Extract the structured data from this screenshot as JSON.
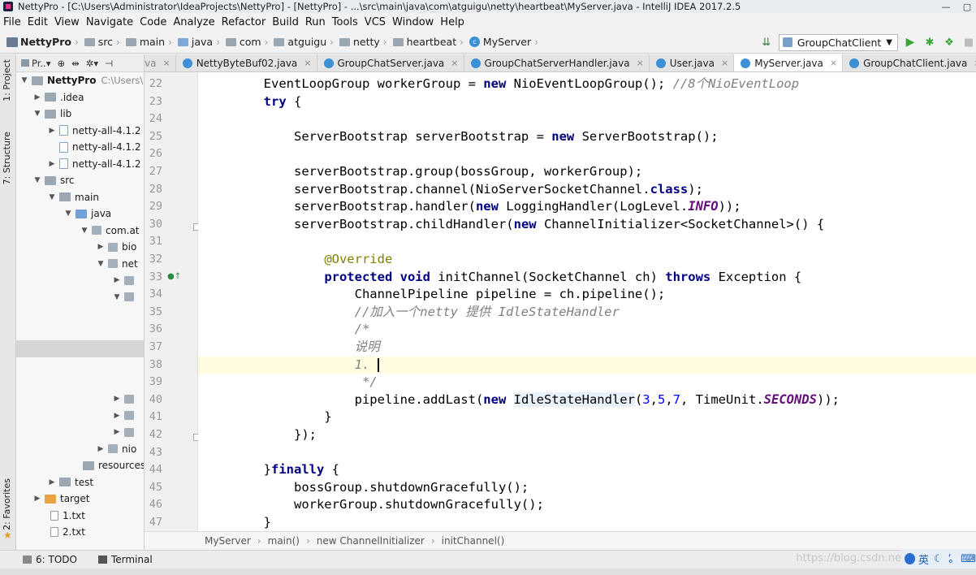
{
  "window": {
    "title": "NettyPro - [C:\\Users\\Administrator\\IdeaProjects\\NettyPro] - [NettyPro] - ...\\src\\main\\java\\com\\atguigu\\netty\\heartbeat\\MyServer.java - IntelliJ IDEA 2017.2.5",
    "minimize": "—"
  },
  "menu": [
    "File",
    "Edit",
    "View",
    "Navigate",
    "Code",
    "Analyze",
    "Refactor",
    "Build",
    "Run",
    "Tools",
    "VCS",
    "Window",
    "Help"
  ],
  "breadcrumb": [
    "NettyPro",
    "src",
    "main",
    "java",
    "com",
    "atguigu",
    "netty",
    "heartbeat",
    "MyServer"
  ],
  "run_config": "GroupChatClient",
  "left_strip": {
    "project": "1: Project",
    "structure": "7: Structure",
    "favorites": "2: Favorites"
  },
  "project_panel": {
    "header": "Pr..▾",
    "rows": [
      {
        "label": "NettyPro",
        "secondary": "C:\\Users\\"
      },
      {
        "label": ".idea"
      },
      {
        "label": "lib"
      },
      {
        "label": "netty-all-4.1.2"
      },
      {
        "label": "netty-all-4.1.2"
      },
      {
        "label": "netty-all-4.1.2"
      },
      {
        "label": "src"
      },
      {
        "label": "main"
      },
      {
        "label": "java"
      },
      {
        "label": "com.at"
      },
      {
        "label": "bio"
      },
      {
        "label": "net"
      },
      {
        "label": "nio"
      },
      {
        "label": "resources"
      },
      {
        "label": "test"
      },
      {
        "label": "target"
      },
      {
        "label": "1.txt"
      },
      {
        "label": "2.txt"
      }
    ]
  },
  "tabs": [
    {
      "label": "va"
    },
    {
      "label": "NettyByteBuf02.java"
    },
    {
      "label": "GroupChatServer.java"
    },
    {
      "label": "GroupChatServerHandler.java"
    },
    {
      "label": "User.java"
    },
    {
      "label": "MyServer.java"
    },
    {
      "label": "GroupChatClient.java"
    }
  ],
  "line_numbers": [
    "22",
    "23",
    "24",
    "25",
    "26",
    "27",
    "28",
    "29",
    "30",
    "31",
    "32",
    "33",
    "34",
    "35",
    "36",
    "37",
    "38",
    "39",
    "40",
    "41",
    "42",
    "43",
    "44",
    "45",
    "46",
    "47"
  ],
  "code": {
    "l22a": "        EventLoopGroup workerGroup = ",
    "l22b": "new",
    "l22c": " NioEventLoopGroup(); ",
    "l22d": "//8个NioEventLoop",
    "l23a": "try",
    "l23b": " {",
    "l25a": "            ServerBootstrap serverBootstrap = ",
    "l25b": "new",
    "l25c": " ServerBootstrap();",
    "l27": "            serverBootstrap.group(bossGroup, workerGroup);",
    "l28a": "            serverBootstrap.channel(NioServerSocketChannel.",
    "l28b": "class",
    "l28c": ");",
    "l29a": "            serverBootstrap.handler(",
    "l29b": "new",
    "l29c": " LoggingHandler(LogLevel.",
    "l29d": "INFO",
    "l29e": "));",
    "l30a": "            serverBootstrap.childHandler(",
    "l30b": "new",
    "l30c": " ChannelInitializer<SocketChannel>() {",
    "l32": "@Override",
    "l33a": "protected void",
    "l33b": " initChannel(SocketChannel ch) ",
    "l33c": "throws",
    "l33d": " Exception {",
    "l34": "                    ChannelPipeline pipeline = ch.pipeline();",
    "l35": "//加入一个netty 提供 IdleStateHandler",
    "l36": "/*",
    "l37": "说明",
    "l38": "1. ",
    "l39": " */",
    "l40a": "                    pipeline.addLast(",
    "l40b": "new",
    "l40c": "IdleStateHandler",
    "l40d": "(",
    "l40e": "3",
    "l40f": ",",
    "l40g": "5",
    "l40h": ",",
    "l40i": "7",
    "l40j": ", TimeUnit.",
    "l40k": "SECONDS",
    "l40l": "));",
    "l41": "                }",
    "l42": "            });",
    "l44a": "        }",
    "l44b": "finally",
    "l44c": " {",
    "l45": "            bossGroup.shutdownGracefully();",
    "l46": "            workerGroup.shutdownGracefully();",
    "l47": "        }"
  },
  "editor_crumbs": [
    "MyServer",
    "main()",
    "new ChannelInitializer",
    "initChannel()"
  ],
  "bottom_tools": [
    "6: TODO",
    "Terminal"
  ],
  "watermark": "https://blog.csdn.ne",
  "ime": "英"
}
